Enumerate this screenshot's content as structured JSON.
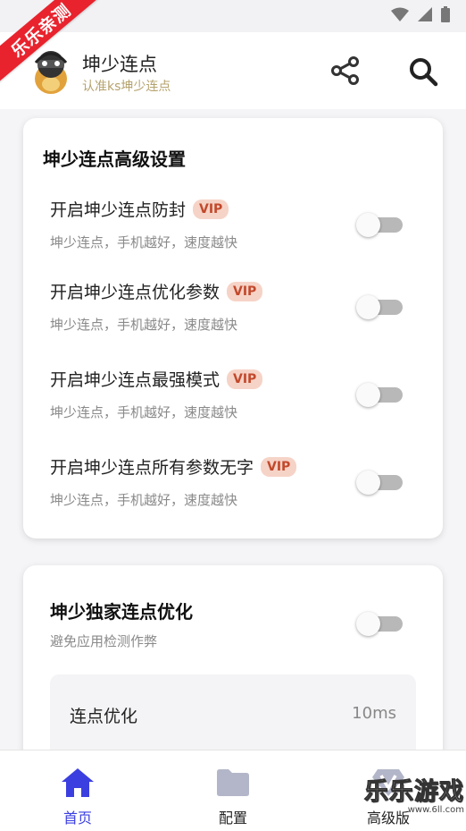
{
  "ribbon": {
    "text": "乐乐亲测"
  },
  "header": {
    "app_name": "坤少连点",
    "app_subtitle": "认准ks坤少连点"
  },
  "icons": {
    "share": "share-icon",
    "search": "search-icon",
    "home": "home-icon",
    "config": "folder-icon",
    "advanced": "vip-diamond-icon"
  },
  "card1": {
    "title": "坤少连点高级设置",
    "settings": [
      {
        "title": "开启坤少连点防封",
        "badge": "VIP",
        "subtitle": "坤少连点，手机越好，速度越快",
        "enabled": false
      },
      {
        "title": "开启坤少连点优化参数",
        "badge": "VIP",
        "subtitle": "坤少连点，手机越好，速度越快",
        "enabled": false
      },
      {
        "title": "开启坤少连点最强模式",
        "badge": "VIP",
        "subtitle": "坤少连点，手机越好，速度越快",
        "enabled": false
      },
      {
        "title": "开启坤少连点所有参数无字",
        "badge": "VIP",
        "subtitle": "坤少连点，手机越好，速度越快",
        "enabled": false
      }
    ]
  },
  "card2": {
    "title": "坤少独家连点优化",
    "subtitle": "避免应用检测作弊",
    "enabled": false,
    "option": {
      "label": "连点优化",
      "value": "10ms"
    }
  },
  "nav": {
    "home": "首页",
    "config": "配置",
    "advanced": "高级版"
  },
  "watermark": {
    "text": "乐乐游戏",
    "url": "www.6ll.com"
  },
  "colors": {
    "accent": "#3b3fe0",
    "vip_bg": "#f6d3c7",
    "vip_text": "#c2492c",
    "subtitle_gold": "#b5a36e",
    "ribbon": "#e8232d"
  }
}
